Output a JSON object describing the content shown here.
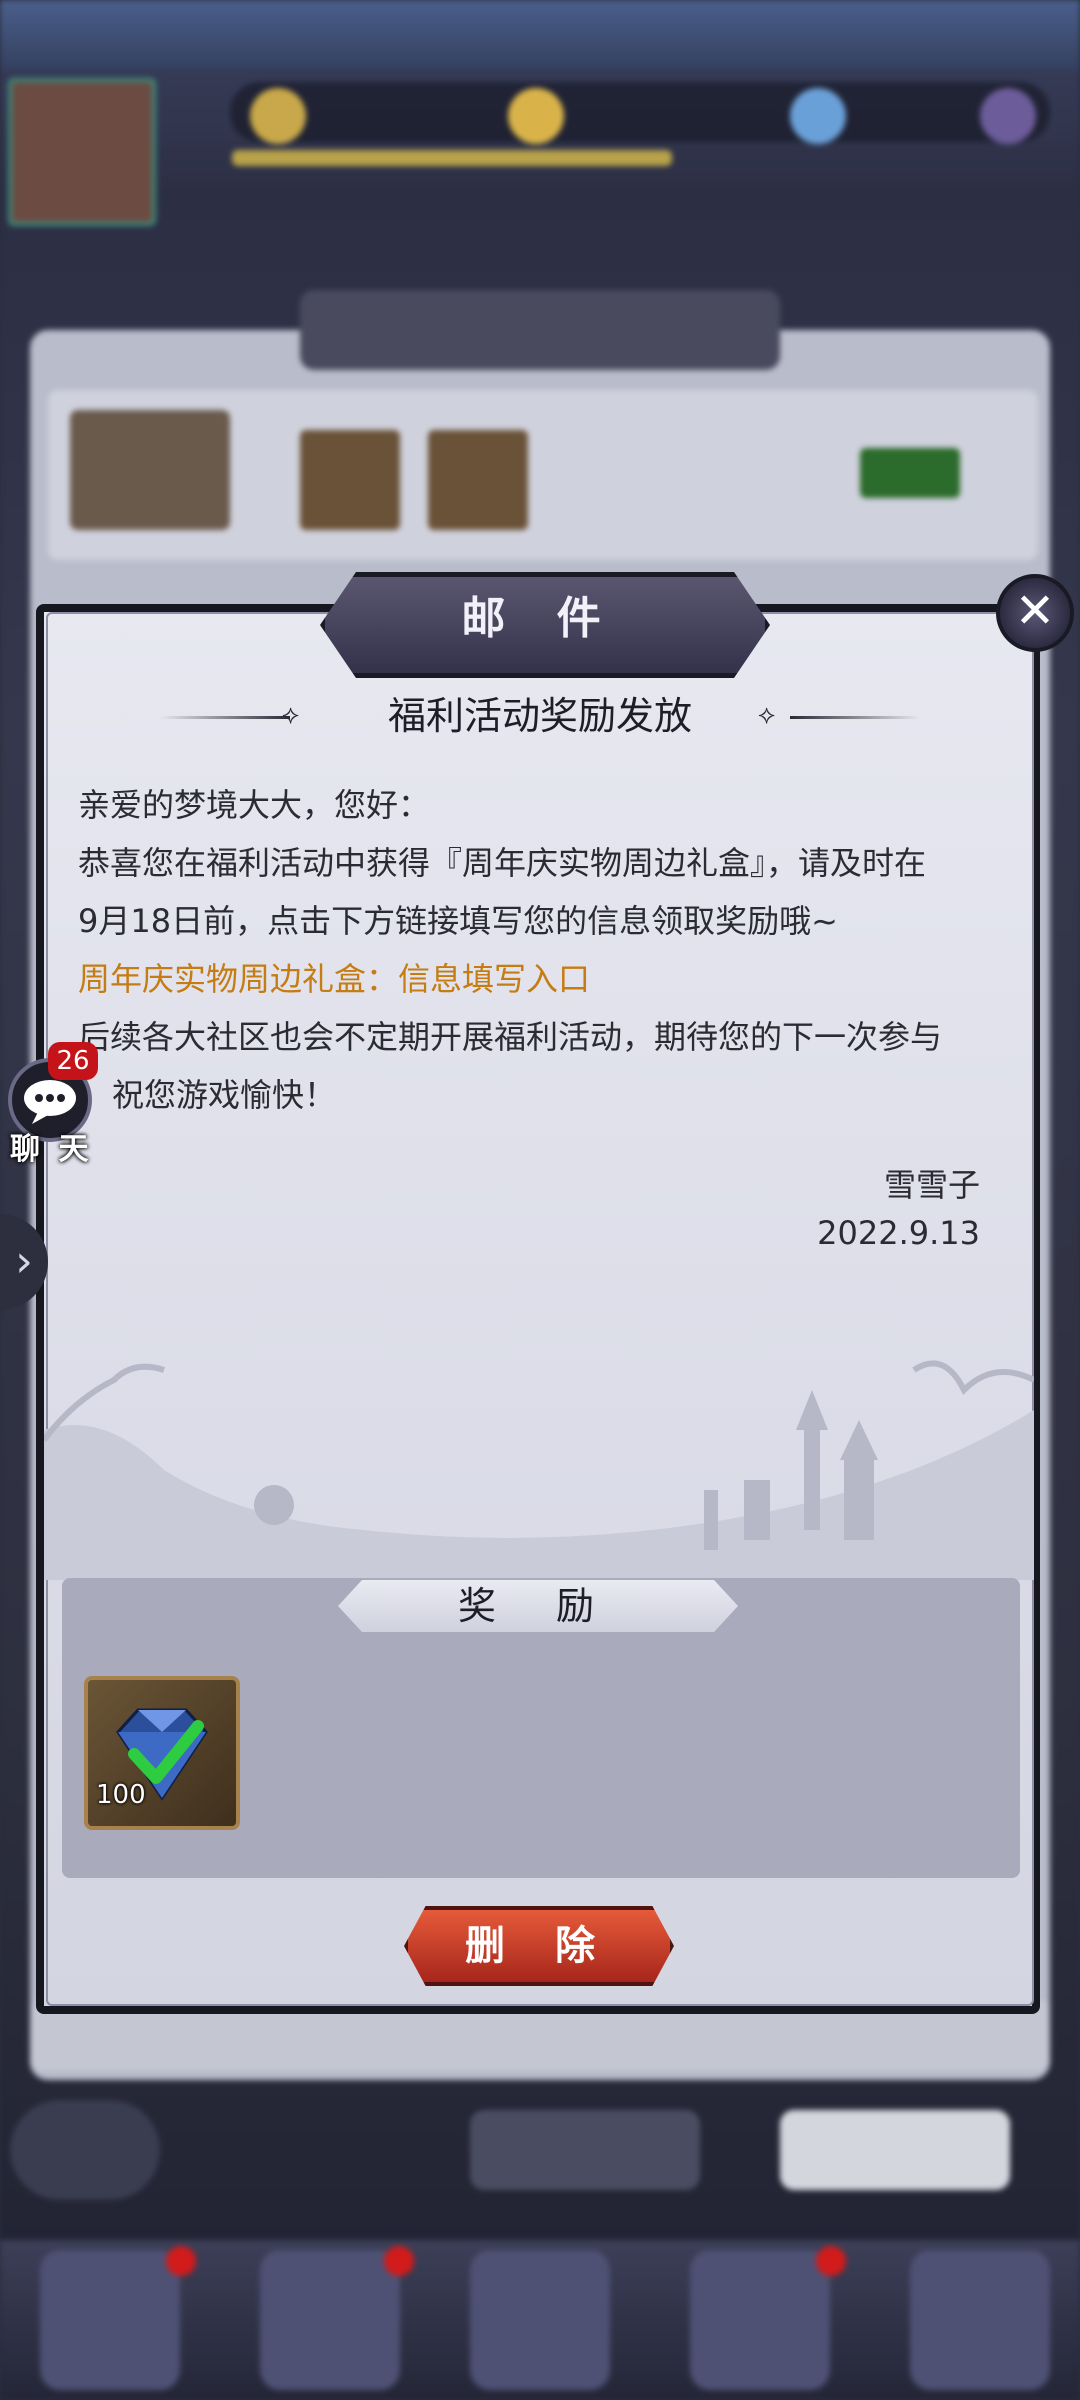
{
  "dialog": {
    "title": "邮 件",
    "subject": "福利活动奖励发放",
    "lines": [
      "亲爱的梦境大大，您好：",
      "恭喜您在福利活动中获得『周年庆实物周边礼盒』，请及时在",
      "9月18日前，点击下方链接填写您的信息领取奖励哦~",
      "周年庆实物周边礼盒：信息填写入口",
      "后续各大社区也会不定期开展福利活动，期待您的下一次参与",
      "祝您游戏愉快！"
    ],
    "sender": "雪雪子",
    "date": "2022.9.13",
    "close_icon": "close-icon"
  },
  "rewards": {
    "title": "奖 励",
    "items": [
      {
        "icon": "diamond-icon",
        "count": "100"
      }
    ]
  },
  "delete_label": "删 除",
  "chat": {
    "badge": "26",
    "label": "聊 天",
    "icon": "chat-bubble-icon"
  },
  "side_arrow": "›",
  "colors": {
    "link": "#c57c12",
    "delete_button": "#d4452c",
    "badge": "#c4141a",
    "dialog_bg": "#e3e4ed"
  }
}
